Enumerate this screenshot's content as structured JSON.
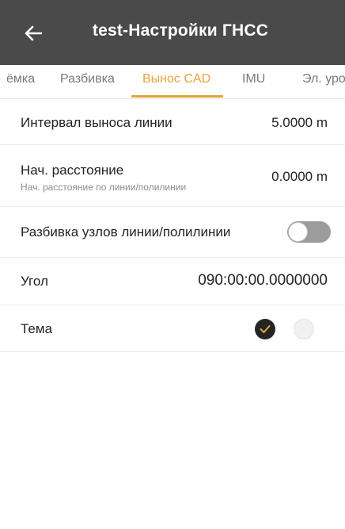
{
  "appbar": {
    "title": "test-Настройки ГНСС",
    "back_icon": "arrow-left-icon"
  },
  "tabs": [
    {
      "label": "ёмка",
      "active": false
    },
    {
      "label": "Разбивка",
      "active": false
    },
    {
      "label": "Вынос CAD",
      "active": true
    },
    {
      "label": "IMU",
      "active": false
    },
    {
      "label": "Эл. уро",
      "active": false
    }
  ],
  "settings": {
    "line_interval": {
      "label": "Интервал выноса линии",
      "value": "5.0000 m"
    },
    "start_distance": {
      "label": "Нач. расстояние",
      "sublabel": "Нач. расстояние по линии/полилинии",
      "value": "0.0000 m"
    },
    "node_staking": {
      "label": "Разбивка узлов линии/полилинии",
      "enabled": false
    },
    "angle": {
      "label": "Угол",
      "value": "090:00:00.0000000"
    },
    "theme": {
      "label": "Тема",
      "selected": "dark"
    }
  },
  "colors": {
    "appbar_bg": "#4a4a4a",
    "accent": "#e8a33c",
    "toggle_off": "#9c9c9c",
    "theme_dark": "#252525",
    "theme_light": "#f1f1f1"
  }
}
